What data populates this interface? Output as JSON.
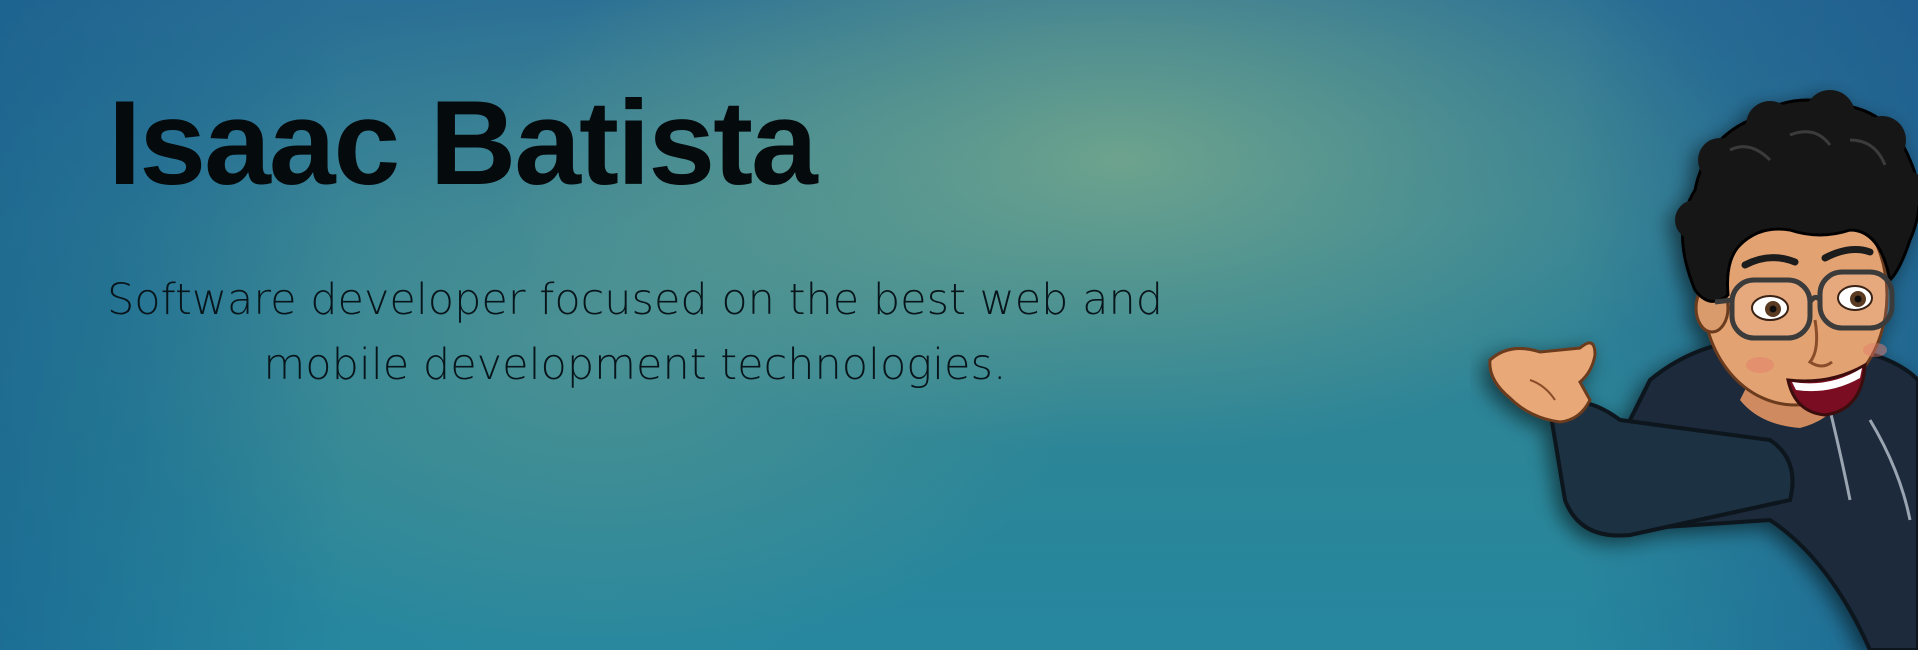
{
  "banner": {
    "title": "Isaac Batista",
    "subtitle": "Software developer focused on the best web and mobile development technologies."
  },
  "avatar": {
    "icon": "bitmoji-avatar-icon",
    "hoodie_color": "#1b2a3a",
    "hair_color": "#141414",
    "skin_color": "#d99a6c"
  },
  "colors": {
    "background_top": "#2a6f95",
    "background_glow": "#6ea58c",
    "text": "#050a0c"
  }
}
